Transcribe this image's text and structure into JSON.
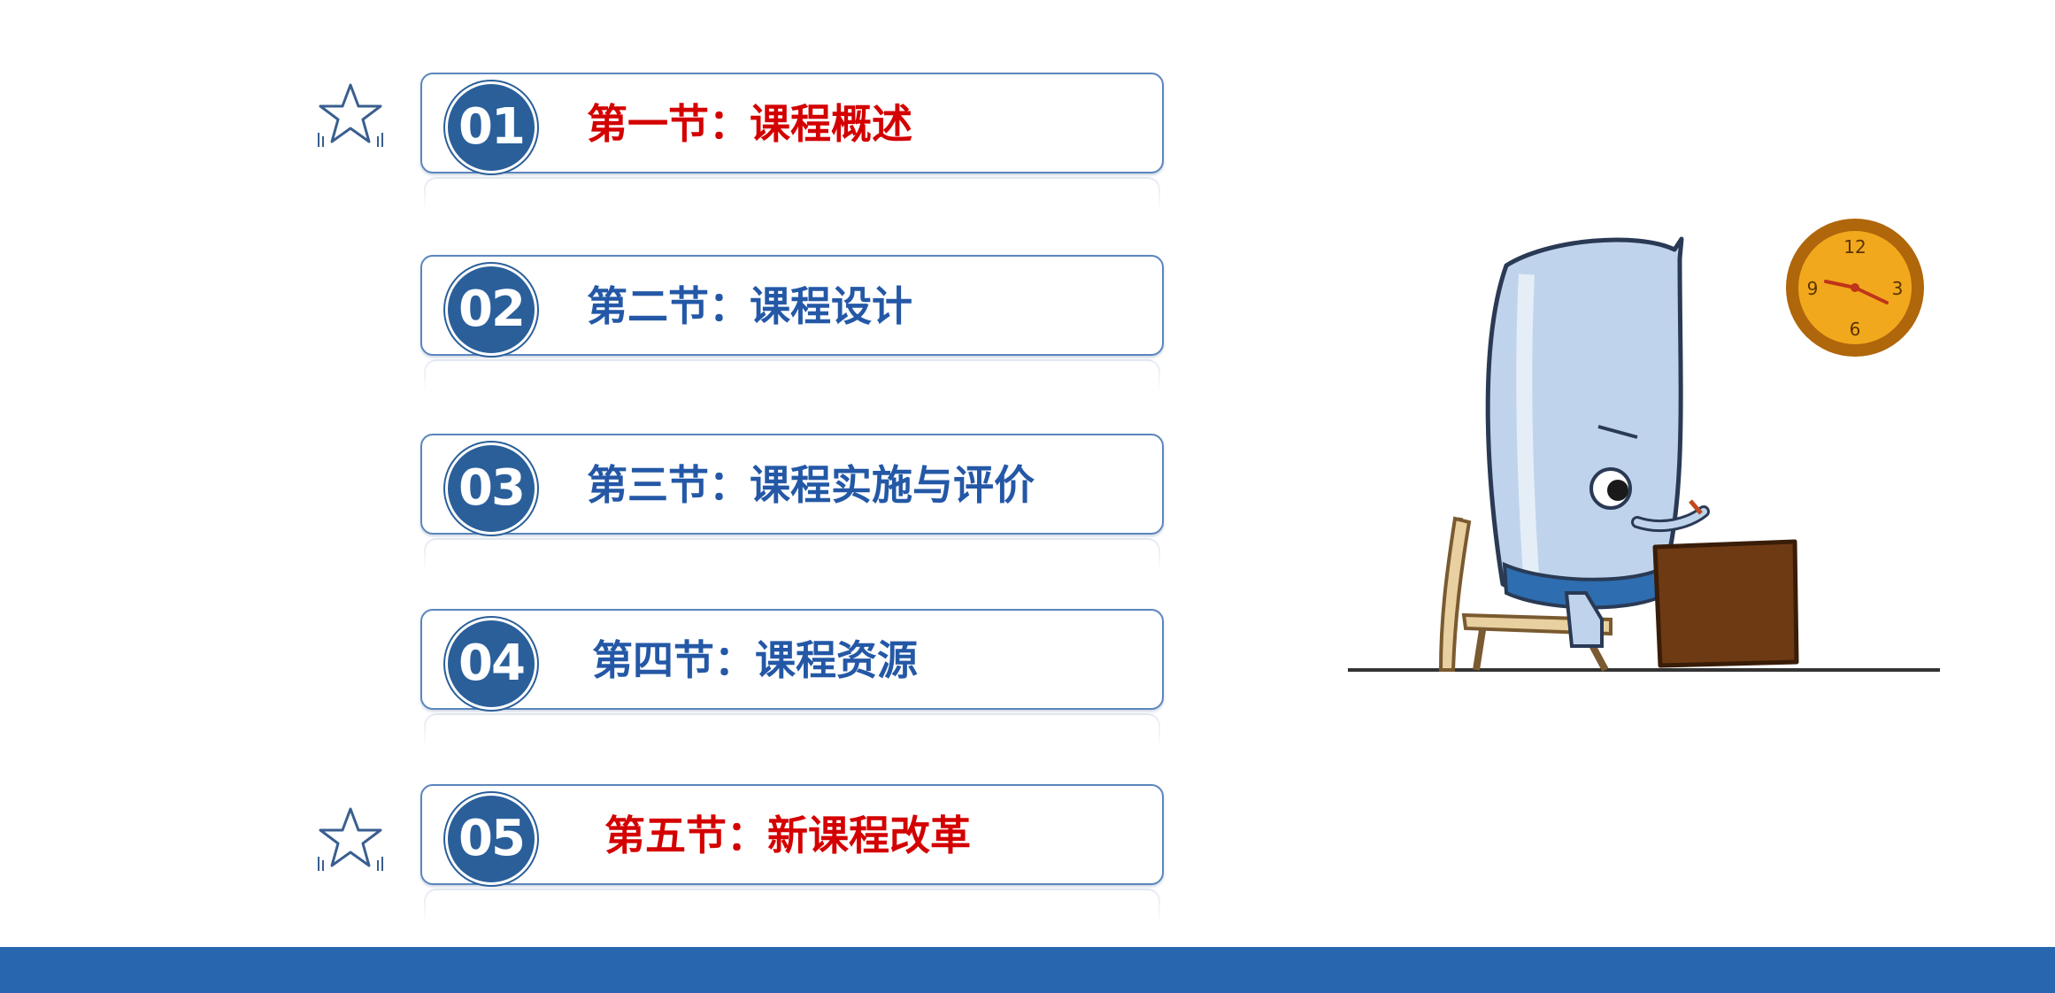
{
  "colors": {
    "highlight": "#d40000",
    "normal": "#2458a6",
    "circle": "#2a5f9a",
    "bar": "#2867b0"
  },
  "sections": [
    {
      "number": "01",
      "label": "第一节：课程概述",
      "highlight": true
    },
    {
      "number": "02",
      "label": "第二节：课程设计",
      "highlight": false
    },
    {
      "number": "03",
      "label": "第三节：课程实施与评价",
      "highlight": false
    },
    {
      "number": "04",
      "label": "第四节：课程资源",
      "highlight": false
    },
    {
      "number": "05",
      "label": "第五节：新课程改革",
      "highlight": true
    }
  ],
  "icons": {
    "star": "star-icon",
    "clock": "clock-icon",
    "character": "writing-character-illustration"
  },
  "clock": {
    "numerals": [
      "12",
      "3",
      "6",
      "9"
    ]
  }
}
